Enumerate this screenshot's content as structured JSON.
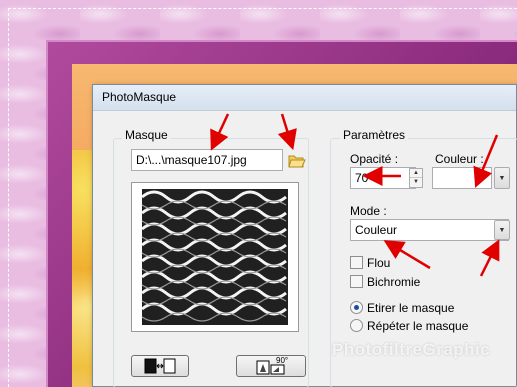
{
  "dialog": {
    "title": "PhotoMasque"
  },
  "masque": {
    "group_label": "Masque",
    "file_value": "D:\\...\\masque107.jpg",
    "folder_icon": "folder-open-icon",
    "invert_icon": "invert-mask-icon",
    "rotate_icon": "rotate-90-icon",
    "rotate_glyph": "90°"
  },
  "parametres": {
    "group_label": "Paramètres",
    "opacite_label": "Opacité :",
    "opacite_value": "70",
    "couleur_label": "Couleur :",
    "couleur_value": "#ffffff",
    "mode_label": "Mode :",
    "mode_value": "Couleur",
    "flou_label": "Flou",
    "flou_checked": false,
    "bichromie_label": "Bichromie",
    "bichromie_checked": false,
    "radio_etirer_label": "Etirer le masque",
    "radio_repeter_label": "Répéter le masque",
    "selected_radio": "etirer"
  },
  "watermark": "PhotofiltreGraphic",
  "colors": {
    "arrow": "#e00000",
    "frame_purple": "#9c3a8c",
    "dialog_bg": "#f0f0f0"
  }
}
